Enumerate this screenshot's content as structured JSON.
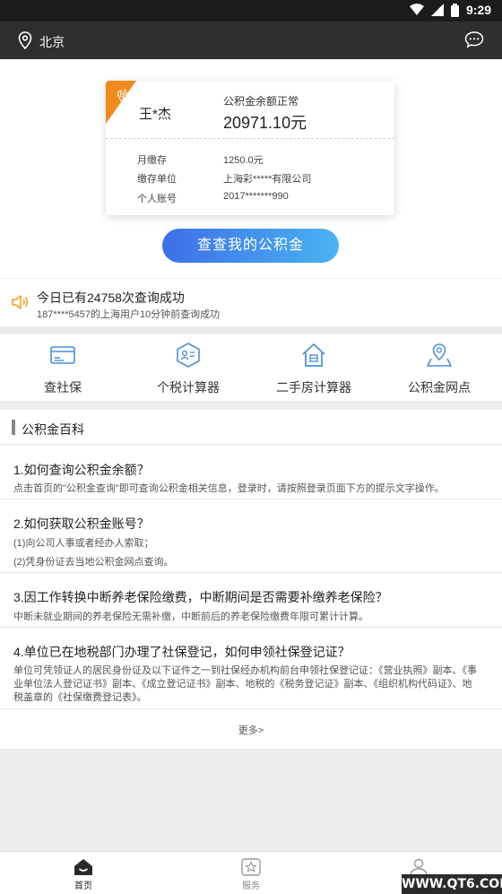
{
  "status_bar": {
    "time": "9:29"
  },
  "header": {
    "city": "北京"
  },
  "card": {
    "ribbon": "例",
    "name": "王*杰",
    "balance_label": "公积金余额正常",
    "balance_value": "20971.10元",
    "rows": [
      {
        "label": "月缴存",
        "value": "1250.0元"
      },
      {
        "label": "缴存单位",
        "value": "上海彩*****有限公司"
      },
      {
        "label": "个人账号",
        "value": "2017*******990"
      }
    ]
  },
  "query_button": "查查我的公积金",
  "notice": {
    "main": "今日已有24758次查询成功",
    "sub": "187****5457的上海用户10分钟前查询成功"
  },
  "tools": [
    {
      "label": "查社保",
      "icon": "card-icon"
    },
    {
      "label": "个税计算器",
      "icon": "tax-icon"
    },
    {
      "label": "二手房计算器",
      "icon": "house-icon"
    },
    {
      "label": "公积金网点",
      "icon": "map-pin-icon"
    }
  ],
  "wiki": {
    "title": "公积金百科",
    "items": [
      {
        "q": "1.如何查询公积金余额？",
        "a": "点击首页的\"公积金查询\"即可查询公积金相关信息，登录时，请按照登录页面下方的提示文字操作。"
      },
      {
        "q": "2.如何获取公积金账号？",
        "a": "(1)向公司人事或者经办人索取；",
        "a2": "(2)凭身份证去当地公积金网点查询。"
      },
      {
        "q": "3.因工作转换中断养老保险缴费，中断期间是否需要补缴养老保险？",
        "a": "中断未就业期间的养老保险无需补缴，中断前后的养老保险缴费年限可累计计算。"
      },
      {
        "q": "4.单位已在地税部门办理了社保登记，如何申领社保登记证？",
        "a": "单位可凭领证人的居民身份证及以下证件之一到社保经办机构前台申领社保登记证：《营业执照》副本、《事业单位法人登记证书》副本、《成立登记证书》副本、地税的《税务登记证》副本、《组织机构代码证》、地税盖章的《社保缴费登记表》。"
      }
    ],
    "more": "更多>"
  },
  "tabbar": [
    {
      "label": "首页",
      "icon": "home-icon"
    },
    {
      "label": "服务",
      "icon": "star-icon"
    },
    {
      "label": "",
      "icon": "user-icon"
    }
  ],
  "watermark": "WWW.QT6.COM",
  "colors": {
    "accent_orange": "#f08a1c",
    "accent_blue": "#3d6fe8",
    "header_bg": "#2f2f2f"
  }
}
